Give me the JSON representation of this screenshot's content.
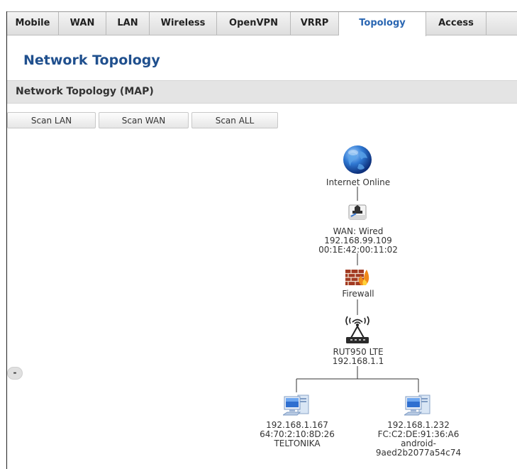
{
  "tabs": [
    {
      "label": "Mobile"
    },
    {
      "label": "WAN"
    },
    {
      "label": "LAN"
    },
    {
      "label": "Wireless"
    },
    {
      "label": "OpenVPN"
    },
    {
      "label": "VRRP"
    },
    {
      "label": "Topology",
      "active": true
    },
    {
      "label": "Access"
    }
  ],
  "page_title": "Network Topology",
  "section_title": "Network Topology (MAP)",
  "buttons": {
    "scan_lan": "Scan LAN",
    "scan_wan": "Scan WAN",
    "scan_all": "Scan ALL"
  },
  "zoom_control": "-",
  "colors": {
    "accent": "#2a66b2",
    "title": "#20508e",
    "section_bg": "#e4e4e4"
  },
  "topology": {
    "internet": {
      "label": "Internet Online",
      "icon": "globe-icon"
    },
    "wan": {
      "line1": "WAN: Wired",
      "line2": "192.168.99.109",
      "line3": "00:1E:42:00:11:02",
      "icon": "ethernet-port-icon"
    },
    "firewall": {
      "label": "Firewall",
      "icon": "firewall-icon"
    },
    "router": {
      "line1": "RUT950 LTE",
      "line2": "192.168.1.1",
      "icon": "router-icon"
    },
    "clients": [
      {
        "line1": "192.168.1.167",
        "line2": "64:70:2:10:8D:26",
        "line3": "TELTONIKA",
        "icon": "computer-icon"
      },
      {
        "line1": "192.168.1.232",
        "line2": "FC:C2:DE:91:36:A6",
        "line3": "android-",
        "line4": "9aed2b2077a54c74",
        "icon": "computer-icon"
      }
    ]
  }
}
